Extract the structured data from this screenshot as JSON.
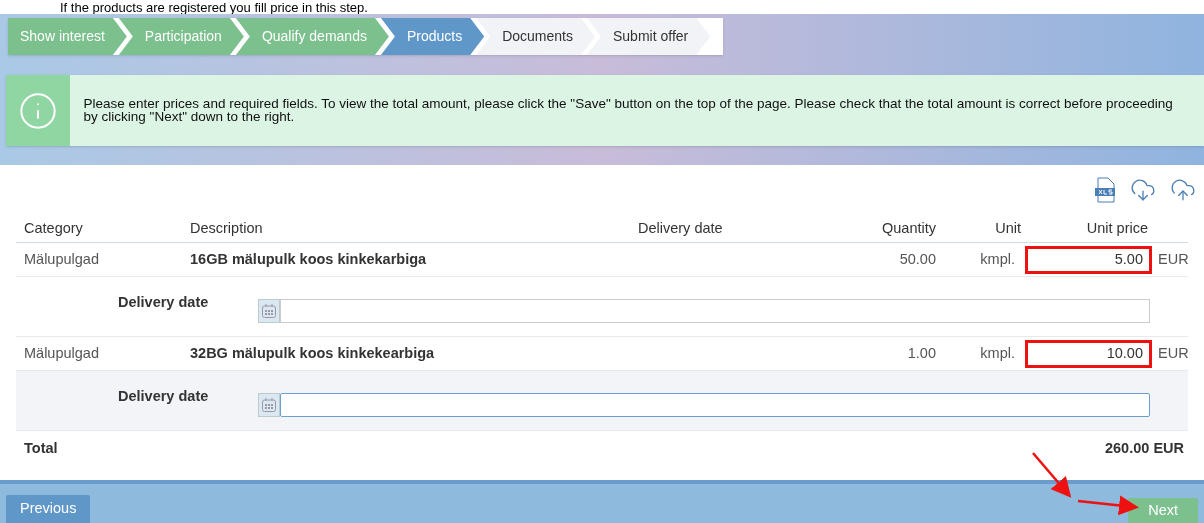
{
  "caption": "If the products are registered you fill price in this step.",
  "steps": [
    {
      "label": "Show interest",
      "selected": false
    },
    {
      "label": "Participation",
      "selected": false
    },
    {
      "label": "Qualify demands",
      "selected": false
    },
    {
      "label": "Products",
      "selected": true
    },
    {
      "label": "Documents",
      "selected": false
    },
    {
      "label": "Submit offer",
      "selected": false
    }
  ],
  "info": "Please enter prices and required fields. To view the total amount, please click the \"Save\" button on the top of the page. Please check that the total amount is correct before proceeding by clicking \"Next\" down to the right.",
  "table": {
    "columns": [
      "Category",
      "Description",
      "Delivery date",
      "Quantity",
      "Unit",
      "Unit price"
    ],
    "rows": [
      {
        "category": "Mälupulgad",
        "description": "16GB mälupulk koos kinkekarbiga",
        "quantity": "50.00",
        "unit": "kmpl.",
        "price": "5.00",
        "currency": "EUR",
        "highlighted": true,
        "delivery_label": "Delivery date",
        "delivery_focused": false
      },
      {
        "category": "Mälupulgad",
        "description": "32BG mälupulk koos kinkekearbiga",
        "quantity": "1.00",
        "unit": "kmpl.",
        "price": "10.00",
        "currency": "EUR",
        "highlighted": true,
        "delivery_label": "Delivery date",
        "delivery_focused": true
      }
    ],
    "total_label": "Total",
    "total": "260.00",
    "total_currency": "EUR"
  },
  "buttons": {
    "previous": "Previous",
    "next": "Next"
  }
}
